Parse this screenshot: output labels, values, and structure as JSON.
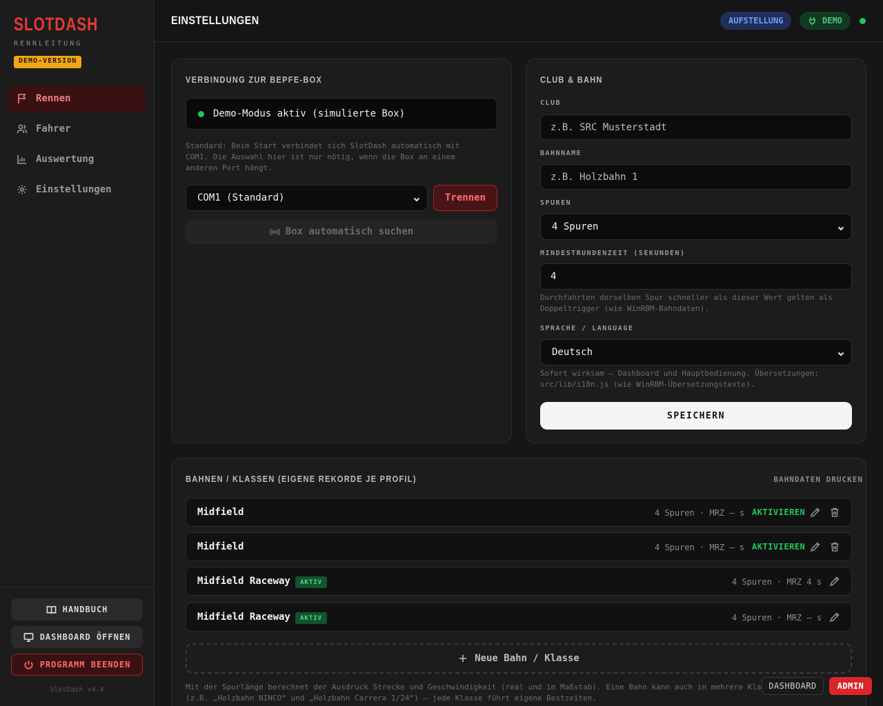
{
  "brand": {
    "title": "SLOTDASH",
    "subtitle": "RENNLEITUNG",
    "badge": "DEMO-VERSION"
  },
  "nav": [
    {
      "label": "Rennen",
      "icon": "flag-icon",
      "active": true
    },
    {
      "label": "Fahrer",
      "icon": "users-icon",
      "active": false
    },
    {
      "label": "Auswertung",
      "icon": "bar-chart-icon",
      "active": false
    },
    {
      "label": "Einstellungen",
      "icon": "gear-icon",
      "active": false
    }
  ],
  "sidebar_bottom": {
    "manual": "HANDBUCH",
    "dashboard": "DASHBOARD ÖFFNEN",
    "quit": "PROGRAMM BEENDEN",
    "version": "SlotDash v4.4"
  },
  "header": {
    "title": "EINSTELLUNGEN",
    "setup_pill": "AUFSTELLUNG",
    "demo_pill": "DEMO"
  },
  "connection": {
    "title": "VERBINDUNG ZUR BEPFE-BOX",
    "status": "Demo-Modus aktiv (simulierte Box)",
    "hint_1": "Standard: Beim Start verbindet sich SlotDash automatisch mit",
    "hint_2": "COM1. Die Auswahl hier ist nur nötig, wenn die Box an einem",
    "hint_3": "anderen Port hängt.",
    "port_value": "COM1 (Standard)",
    "disconnect": "Trennen",
    "auto_search": "Box automatisch suchen"
  },
  "club": {
    "title": "CLUB & BAHN",
    "club_label": "CLUB",
    "club_placeholder": "z.B. SRC Musterstadt",
    "track_label": "BAHNNAME",
    "track_placeholder": "z.B. Holzbahn 1",
    "lanes_label": "SPUREN",
    "lanes_value": "4 Spuren",
    "min_lap_label": "MINDESTRUNDENZEIT (SEKUNDEN)",
    "min_lap_value": "4",
    "min_lap_hint_1": "Durchfahrten derselben Spur schneller als dieser Wert gelten als",
    "min_lap_hint_2": "Doppeltrigger (wie WinRBM-Bahndaten).",
    "language_label": "SPRACHE / LANGUAGE",
    "language_value": "Deutsch",
    "language_hint_1": "Sofort wirksam — Dashboard und Hauptbedienung. Übersetzungen:",
    "language_hint_2": "src/lib/i18n.js (wie WinRBM-Übersetzungstexte).",
    "save": "SPEICHERN"
  },
  "tracks": {
    "title": "BAHNEN / KLASSEN (EIGENE REKORDE JE PROFIL)",
    "print": "BAHNDATEN DRUCKEN",
    "rows": [
      {
        "name": "Midfield",
        "badge": "",
        "meta": "4 Spuren · MRZ — s",
        "action": "AKTIVIEREN"
      },
      {
        "name": "Midfield",
        "badge": "",
        "meta": "4 Spuren · MRZ — s",
        "action": "AKTIVIEREN"
      },
      {
        "name": "Midfield Raceway",
        "badge": "AKTIV",
        "meta": "4 Spuren · MRZ 4 s",
        "action": ""
      },
      {
        "name": "Midfield Raceway",
        "badge": "AKTIV",
        "meta": "4 Spuren · MRZ — s",
        "action": ""
      }
    ],
    "new_track": "Neue Bahn / Klasse",
    "footer_1": "Mit der Spurlänge berechnet der Ausdruck Strecke und Geschwindigkeit (real und im Maßstab). Eine Bahn kann auch in mehrere Klassen",
    "footer_2": "(z.B. „Holzbahn NINCO“ und „Holzbahn Carrera 1/24“) — jede Klasse führt eigene Bestzeiten."
  },
  "floating": {
    "dashboard": "DASHBOARD",
    "admin": "ADMIN"
  },
  "colors": {
    "accent_red": "#e53935",
    "green": "#22c55e",
    "blue": "#6f9cf5",
    "amber": "#f2a516"
  }
}
